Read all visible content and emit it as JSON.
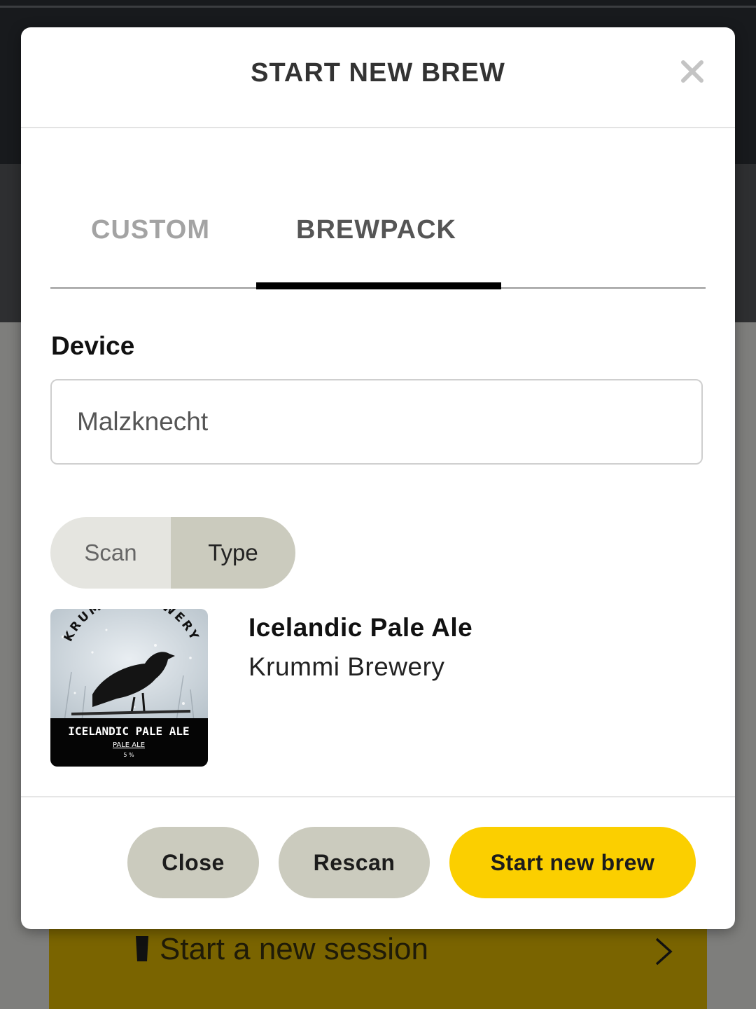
{
  "modal": {
    "title": "START NEW BREW",
    "tabs": [
      {
        "label": "CUSTOM",
        "active": false
      },
      {
        "label": "BREWPACK",
        "active": true
      }
    ],
    "device": {
      "label": "Device",
      "value": "Malzknecht"
    },
    "input_mode": {
      "options": [
        "Scan",
        "Type"
      ],
      "selected": "Type"
    },
    "brewpack": {
      "name": "Icelandic Pale Ale",
      "brewery": "Krummi Brewery",
      "label_art": {
        "arc_text": "KRUMMI BREWERY",
        "title": "ICELANDIC PALE ALE",
        "style": "PALE ALE",
        "abv": "5 %"
      }
    },
    "buttons": {
      "close": "Close",
      "rescan": "Rescan",
      "start": "Start new brew"
    }
  },
  "background": {
    "session_label": "Start a new session"
  },
  "colors": {
    "accent": "#fbcf00",
    "secondary_button": "#cbcbbe"
  }
}
